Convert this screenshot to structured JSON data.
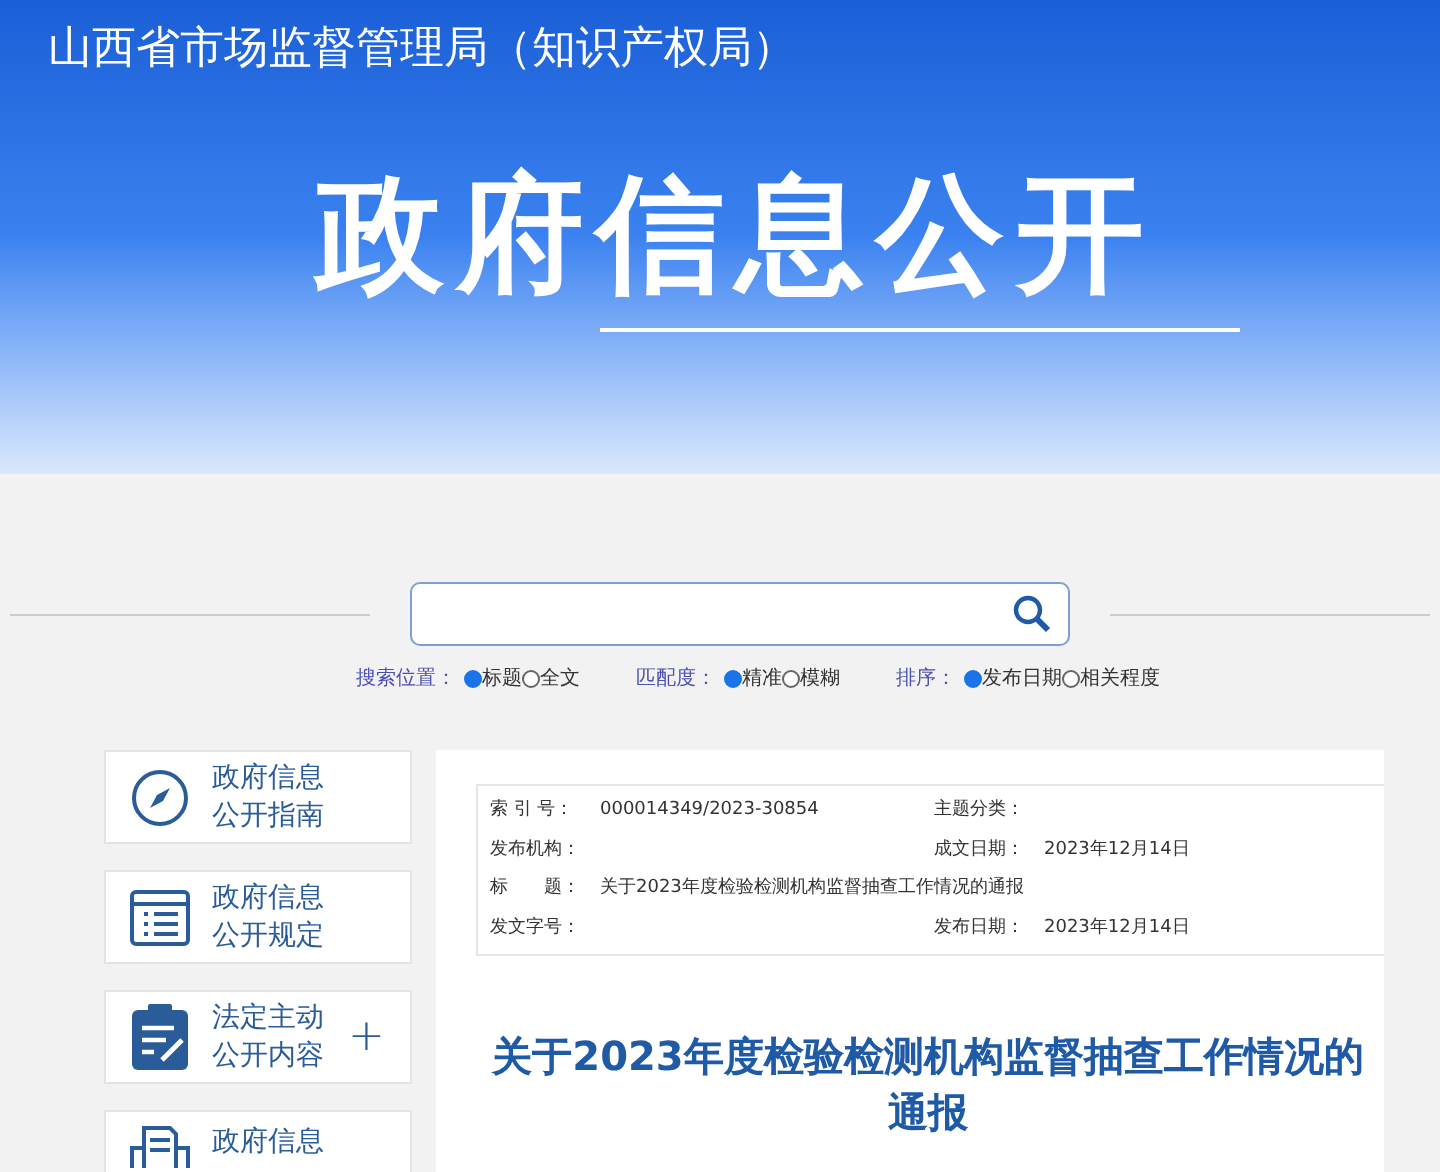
{
  "header": {
    "org_name": "山西省市场监督管理局（知识产权局）",
    "title": "政府信息公开"
  },
  "search_options": [
    {
      "label": "搜索位置：",
      "options": [
        {
          "label": "标题",
          "selected": true
        },
        {
          "label": "全文",
          "selected": false
        }
      ]
    },
    {
      "label": "匹配度：",
      "options": [
        {
          "label": "精准",
          "selected": true
        },
        {
          "label": "模糊",
          "selected": false
        }
      ]
    },
    {
      "label": "排序：",
      "options": [
        {
          "label": "发布日期",
          "selected": true
        },
        {
          "label": "相关程度",
          "selected": false
        }
      ]
    }
  ],
  "sidebar": {
    "items": [
      {
        "kind": "compass",
        "lines": [
          "政府信息",
          "公开指南"
        ]
      },
      {
        "kind": "list",
        "lines": [
          "政府信息",
          "公开规定"
        ]
      },
      {
        "kind": "clipboard",
        "lines": [
          "法定主动",
          "公开内容"
        ],
        "toggle": "+"
      },
      {
        "kind": "printer",
        "lines": [
          "政府信息"
        ]
      }
    ]
  },
  "meta": [
    [
      {
        "label": "索 引 号：",
        "value": "000014349/2023-30854"
      },
      {
        "label": "主题分类："
      }
    ],
    [
      {
        "label": "发布机构："
      },
      {
        "label": "成文日期：",
        "value": "2023年12月14日"
      }
    ],
    [
      {
        "label": "标　　题：",
        "value": "关于2023年度检验检测机构监督抽查工作情况的通报"
      }
    ],
    [
      {
        "label": "发文字号："
      },
      {
        "label": "发布日期：",
        "value": "2023年12月14日"
      }
    ]
  ],
  "article": {
    "title": "关于2023年度检验检测机构监督抽查工作情况的通报"
  }
}
